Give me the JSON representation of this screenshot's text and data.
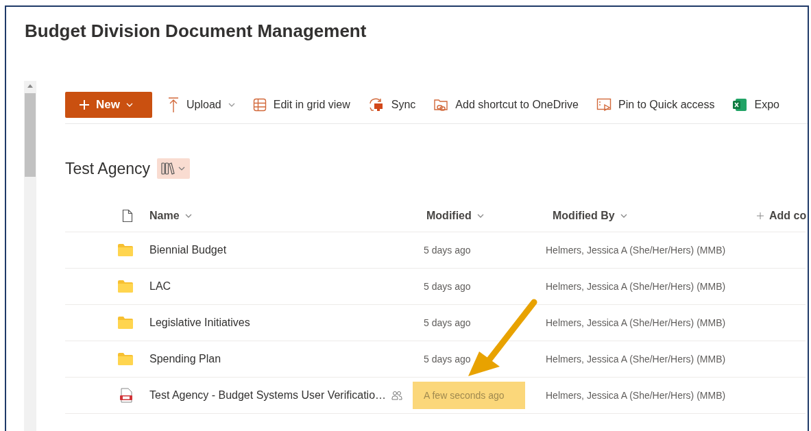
{
  "site": {
    "title": "Budget Division Document Management"
  },
  "toolbar": [
    {
      "kind": "new",
      "label": "New",
      "has_menu": true
    },
    {
      "kind": "upload",
      "label": "Upload",
      "has_menu": true
    },
    {
      "kind": "grid",
      "label": "Edit in grid view",
      "has_menu": false
    },
    {
      "kind": "sync",
      "label": "Sync",
      "has_menu": false
    },
    {
      "kind": "shortcut",
      "label": "Add shortcut to OneDrive",
      "has_menu": false
    },
    {
      "kind": "pin",
      "label": "Pin to Quick access",
      "has_menu": false
    },
    {
      "kind": "excel",
      "label": "Expo",
      "has_menu": false
    }
  ],
  "library": {
    "title": "Test Agency"
  },
  "table": {
    "columns": [
      {
        "label": "Name"
      },
      {
        "label": "Modified"
      },
      {
        "label": "Modified By"
      }
    ],
    "add_column": "Add co",
    "rows": [
      {
        "kind": "folder",
        "name": "Biennial Budget",
        "modified": "5 days ago",
        "modified_by": "Helmers, Jessica A (She/Her/Hers) (MMB)",
        "shared": false,
        "highlighted": false
      },
      {
        "kind": "folder",
        "name": "LAC",
        "modified": "5 days ago",
        "modified_by": "Helmers, Jessica A (She/Her/Hers) (MMB)",
        "shared": false,
        "highlighted": false
      },
      {
        "kind": "folder",
        "name": "Legislative Initiatives",
        "modified": "5 days ago",
        "modified_by": "Helmers, Jessica A (She/Her/Hers) (MMB)",
        "shared": false,
        "highlighted": false
      },
      {
        "kind": "folder",
        "name": "Spending Plan",
        "modified": "5 days ago",
        "modified_by": "Helmers, Jessica A (She/Her/Hers) (MMB)",
        "shared": false,
        "highlighted": false
      },
      {
        "kind": "pdf",
        "name": "Test Agency - Budget Systems User Verificatio…",
        "modified": "A few seconds ago",
        "modified_by": "Helmers, Jessica A (She/Her/Hers) (MMB)",
        "shared": true,
        "highlighted": true
      }
    ]
  }
}
